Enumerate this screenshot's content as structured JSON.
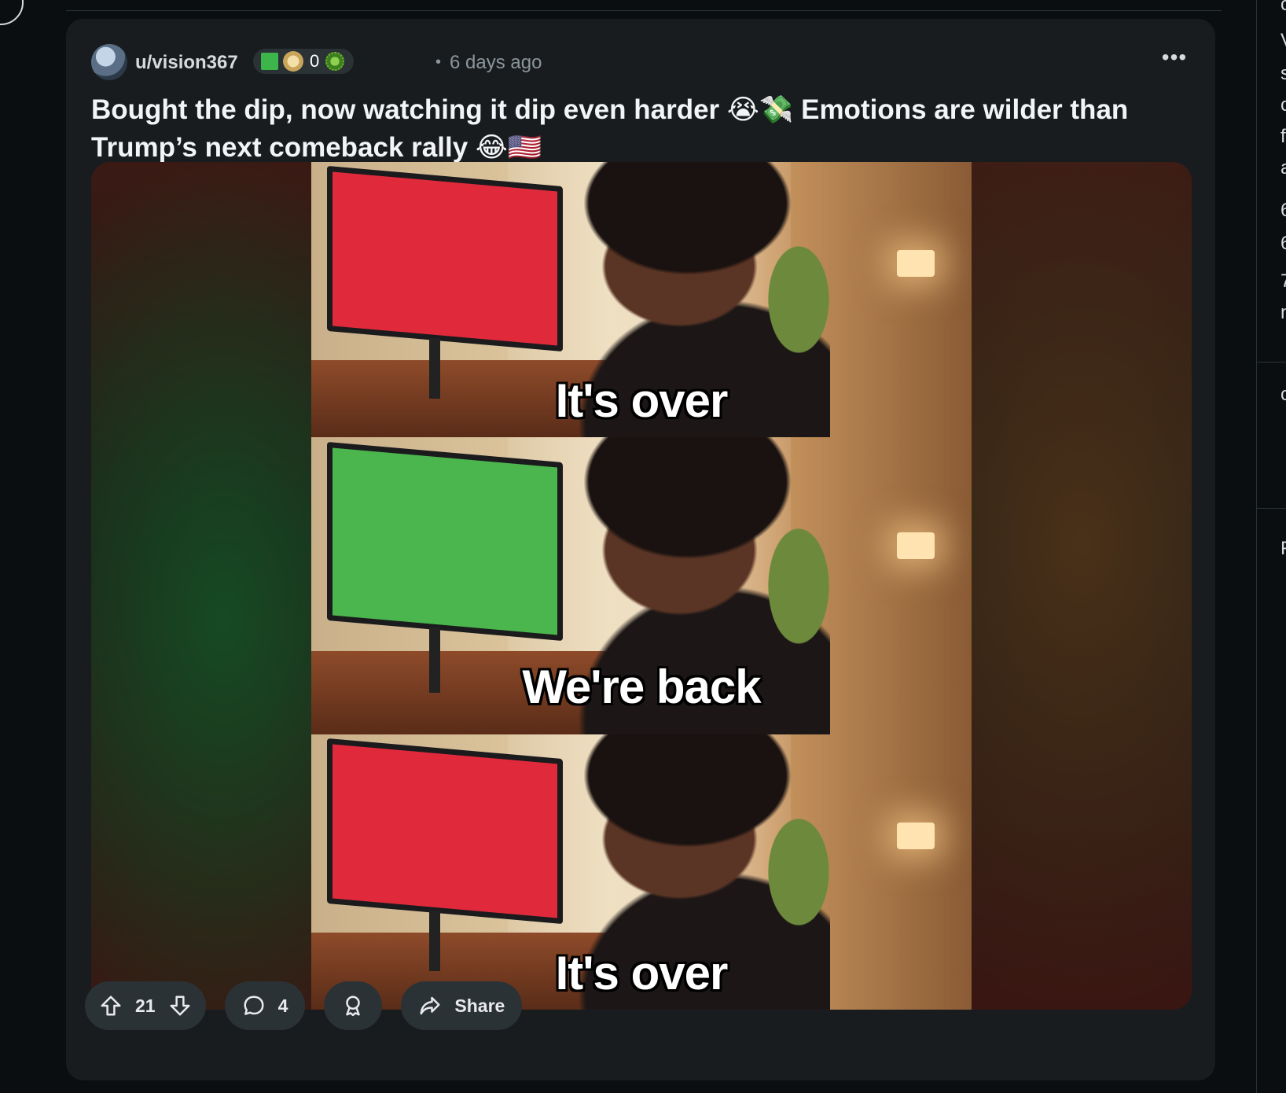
{
  "post": {
    "author": "u/vision367",
    "flair_count": "0",
    "separator": "•",
    "time_ago": "6 days ago",
    "title": "Bought the dip, now watching it dip even harder 😭💸 Emotions are wilder than Trump’s next comeback rally 😂🇺🇸",
    "more_label": "•••"
  },
  "media": {
    "captions": [
      "It's over",
      "We're back",
      "It's over"
    ],
    "screen_colors": [
      "#e02a3c",
      "#4bb54e",
      "#e02a3c"
    ]
  },
  "actions": {
    "vote_count": "21",
    "comment_count": "4",
    "share_label": "Share"
  },
  "right_column_chars": [
    "c",
    "V",
    "s",
    "c",
    "f",
    "a",
    "6",
    "6",
    "7",
    "n",
    "c",
    "F"
  ],
  "colors": {
    "background": "#0b0e10",
    "card": "#181c1f",
    "pill": "#2b3236",
    "muted_text": "#8b969c"
  }
}
